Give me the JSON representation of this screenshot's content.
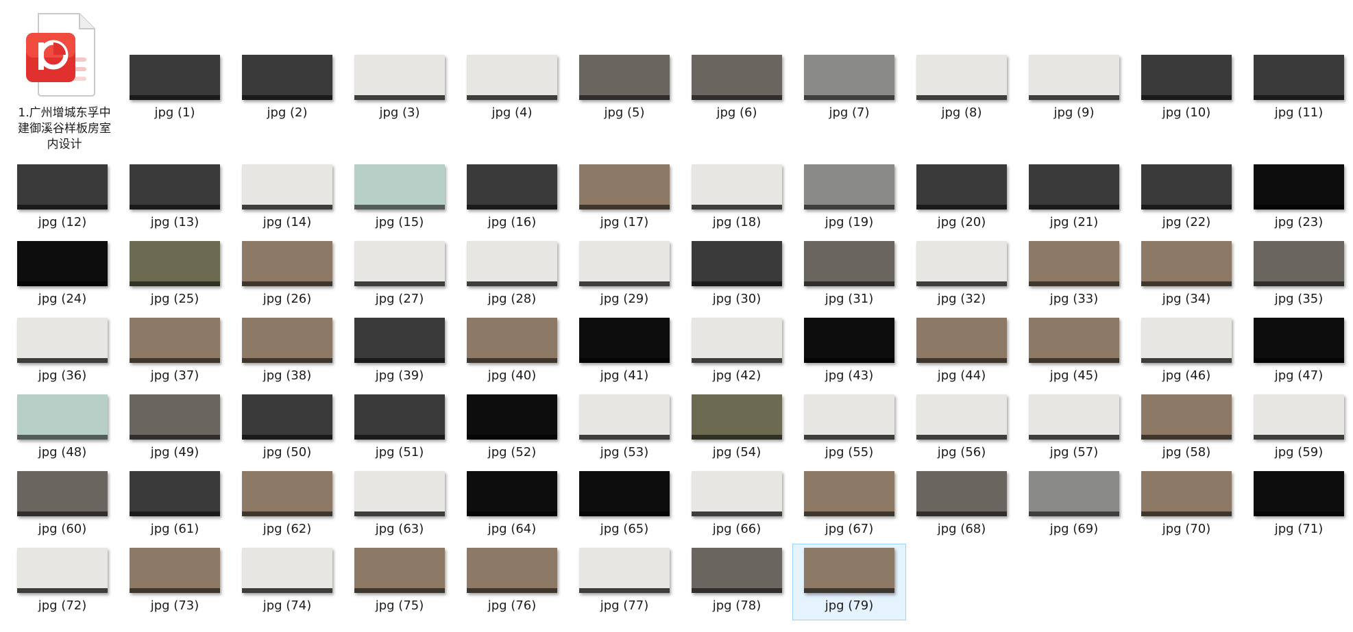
{
  "folder_file": {
    "name": "1.广州增城东孚中建御溪谷样板房室内设计",
    "icon": "ppt-file-icon",
    "accent": "#e0312f"
  },
  "images": [
    {
      "label": "jpg (1)",
      "tone": "dark"
    },
    {
      "label": "jpg (2)",
      "tone": "dark"
    },
    {
      "label": "jpg (3)",
      "tone": "light"
    },
    {
      "label": "jpg (4)",
      "tone": "light"
    },
    {
      "label": "jpg (5)",
      "tone": "mixed"
    },
    {
      "label": "jpg (6)",
      "tone": "mixed"
    },
    {
      "label": "jpg (7)",
      "tone": "gray"
    },
    {
      "label": "jpg (8)",
      "tone": "light"
    },
    {
      "label": "jpg (9)",
      "tone": "light"
    },
    {
      "label": "jpg (10)",
      "tone": "dark"
    },
    {
      "label": "jpg (11)",
      "tone": "dark"
    },
    {
      "label": "jpg (12)",
      "tone": "dark"
    },
    {
      "label": "jpg (13)",
      "tone": "dark"
    },
    {
      "label": "jpg (14)",
      "tone": "light"
    },
    {
      "label": "jpg (15)",
      "tone": "teal"
    },
    {
      "label": "jpg (16)",
      "tone": "dark"
    },
    {
      "label": "jpg (17)",
      "tone": "warm"
    },
    {
      "label": "jpg (18)",
      "tone": "light"
    },
    {
      "label": "jpg (19)",
      "tone": "gray"
    },
    {
      "label": "jpg (20)",
      "tone": "dark"
    },
    {
      "label": "jpg (21)",
      "tone": "dark"
    },
    {
      "label": "jpg (22)",
      "tone": "dark"
    },
    {
      "label": "jpg (23)",
      "tone": "black"
    },
    {
      "label": "jpg (24)",
      "tone": "black"
    },
    {
      "label": "jpg (25)",
      "tone": "olive"
    },
    {
      "label": "jpg (26)",
      "tone": "warm"
    },
    {
      "label": "jpg (27)",
      "tone": "light"
    },
    {
      "label": "jpg (28)",
      "tone": "light"
    },
    {
      "label": "jpg (29)",
      "tone": "light"
    },
    {
      "label": "jpg (30)",
      "tone": "dark"
    },
    {
      "label": "jpg (31)",
      "tone": "mixed"
    },
    {
      "label": "jpg (32)",
      "tone": "light"
    },
    {
      "label": "jpg (33)",
      "tone": "warm"
    },
    {
      "label": "jpg (34)",
      "tone": "warm"
    },
    {
      "label": "jpg (35)",
      "tone": "mixed"
    },
    {
      "label": "jpg (36)",
      "tone": "light"
    },
    {
      "label": "jpg (37)",
      "tone": "warm"
    },
    {
      "label": "jpg (38)",
      "tone": "warm"
    },
    {
      "label": "jpg (39)",
      "tone": "dark"
    },
    {
      "label": "jpg (40)",
      "tone": "warm"
    },
    {
      "label": "jpg (41)",
      "tone": "black"
    },
    {
      "label": "jpg (42)",
      "tone": "light"
    },
    {
      "label": "jpg (43)",
      "tone": "black"
    },
    {
      "label": "jpg (44)",
      "tone": "warm"
    },
    {
      "label": "jpg (45)",
      "tone": "warm"
    },
    {
      "label": "jpg (46)",
      "tone": "light"
    },
    {
      "label": "jpg (47)",
      "tone": "black"
    },
    {
      "label": "jpg (48)",
      "tone": "teal"
    },
    {
      "label": "jpg (49)",
      "tone": "mixed"
    },
    {
      "label": "jpg (50)",
      "tone": "dark"
    },
    {
      "label": "jpg (51)",
      "tone": "dark"
    },
    {
      "label": "jpg (52)",
      "tone": "black"
    },
    {
      "label": "jpg (53)",
      "tone": "light"
    },
    {
      "label": "jpg (54)",
      "tone": "olive"
    },
    {
      "label": "jpg (55)",
      "tone": "light"
    },
    {
      "label": "jpg (56)",
      "tone": "light"
    },
    {
      "label": "jpg (57)",
      "tone": "light"
    },
    {
      "label": "jpg (58)",
      "tone": "warm"
    },
    {
      "label": "jpg (59)",
      "tone": "light"
    },
    {
      "label": "jpg (60)",
      "tone": "mixed"
    },
    {
      "label": "jpg (61)",
      "tone": "dark"
    },
    {
      "label": "jpg (62)",
      "tone": "warm"
    },
    {
      "label": "jpg (63)",
      "tone": "light"
    },
    {
      "label": "jpg (64)",
      "tone": "black"
    },
    {
      "label": "jpg (65)",
      "tone": "black"
    },
    {
      "label": "jpg (66)",
      "tone": "light"
    },
    {
      "label": "jpg (67)",
      "tone": "warm"
    },
    {
      "label": "jpg (68)",
      "tone": "mixed"
    },
    {
      "label": "jpg (69)",
      "tone": "gray"
    },
    {
      "label": "jpg (70)",
      "tone": "warm"
    },
    {
      "label": "jpg (71)",
      "tone": "black"
    },
    {
      "label": "jpg (72)",
      "tone": "light"
    },
    {
      "label": "jpg (73)",
      "tone": "warm"
    },
    {
      "label": "jpg (74)",
      "tone": "light"
    },
    {
      "label": "jpg (75)",
      "tone": "warm"
    },
    {
      "label": "jpg (76)",
      "tone": "warm"
    },
    {
      "label": "jpg (77)",
      "tone": "light"
    },
    {
      "label": "jpg (78)",
      "tone": "mixed"
    },
    {
      "label": "jpg (79)",
      "tone": "warm",
      "selected": true
    }
  ],
  "tones": {
    "dark": "#3a3a3a",
    "light": "#e8e6e2",
    "gray": "#8a8a88",
    "black": "#0d0d0d",
    "teal": "#b7cfc7",
    "warm": "#8c7a66",
    "olive": "#6d6a52",
    "mixed": "#6b6560"
  }
}
